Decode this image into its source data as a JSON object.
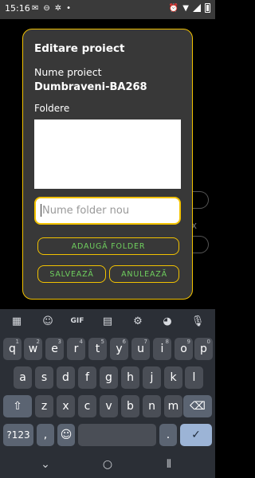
{
  "status_bar": {
    "time": "15:16"
  },
  "dialog": {
    "title": "Editare proiect",
    "name_label": "Nume proiect",
    "name_value": "Dumbraveni-BA268",
    "folders_label": "Foldere",
    "folder_input_placeholder": "Nume folder nou",
    "add_button": "ADAUGĂ FOLDER",
    "save_button": "SALVEAZĂ",
    "cancel_button": "ANULEAZĂ"
  },
  "background": {
    "x_char": "x"
  },
  "keyboard": {
    "toolbar": {
      "gif_label": "GIF"
    },
    "row1": [
      {
        "k": "q",
        "h": "1"
      },
      {
        "k": "w",
        "h": "2"
      },
      {
        "k": "e",
        "h": "3"
      },
      {
        "k": "r",
        "h": "4"
      },
      {
        "k": "t",
        "h": "5"
      },
      {
        "k": "y",
        "h": "6"
      },
      {
        "k": "u",
        "h": "7"
      },
      {
        "k": "i",
        "h": "8"
      },
      {
        "k": "o",
        "h": "9"
      },
      {
        "k": "p",
        "h": "0"
      }
    ],
    "row2": [
      "a",
      "s",
      "d",
      "f",
      "g",
      "h",
      "j",
      "k",
      "l"
    ],
    "row3": [
      "z",
      "x",
      "c",
      "v",
      "b",
      "n",
      "m"
    ],
    "symbols_key": "?123",
    "comma_key": ",",
    "period_key": "."
  },
  "colors": {
    "accent": "#f2c200",
    "button_text": "#6fcf5e",
    "dialog_bg": "#383838"
  }
}
